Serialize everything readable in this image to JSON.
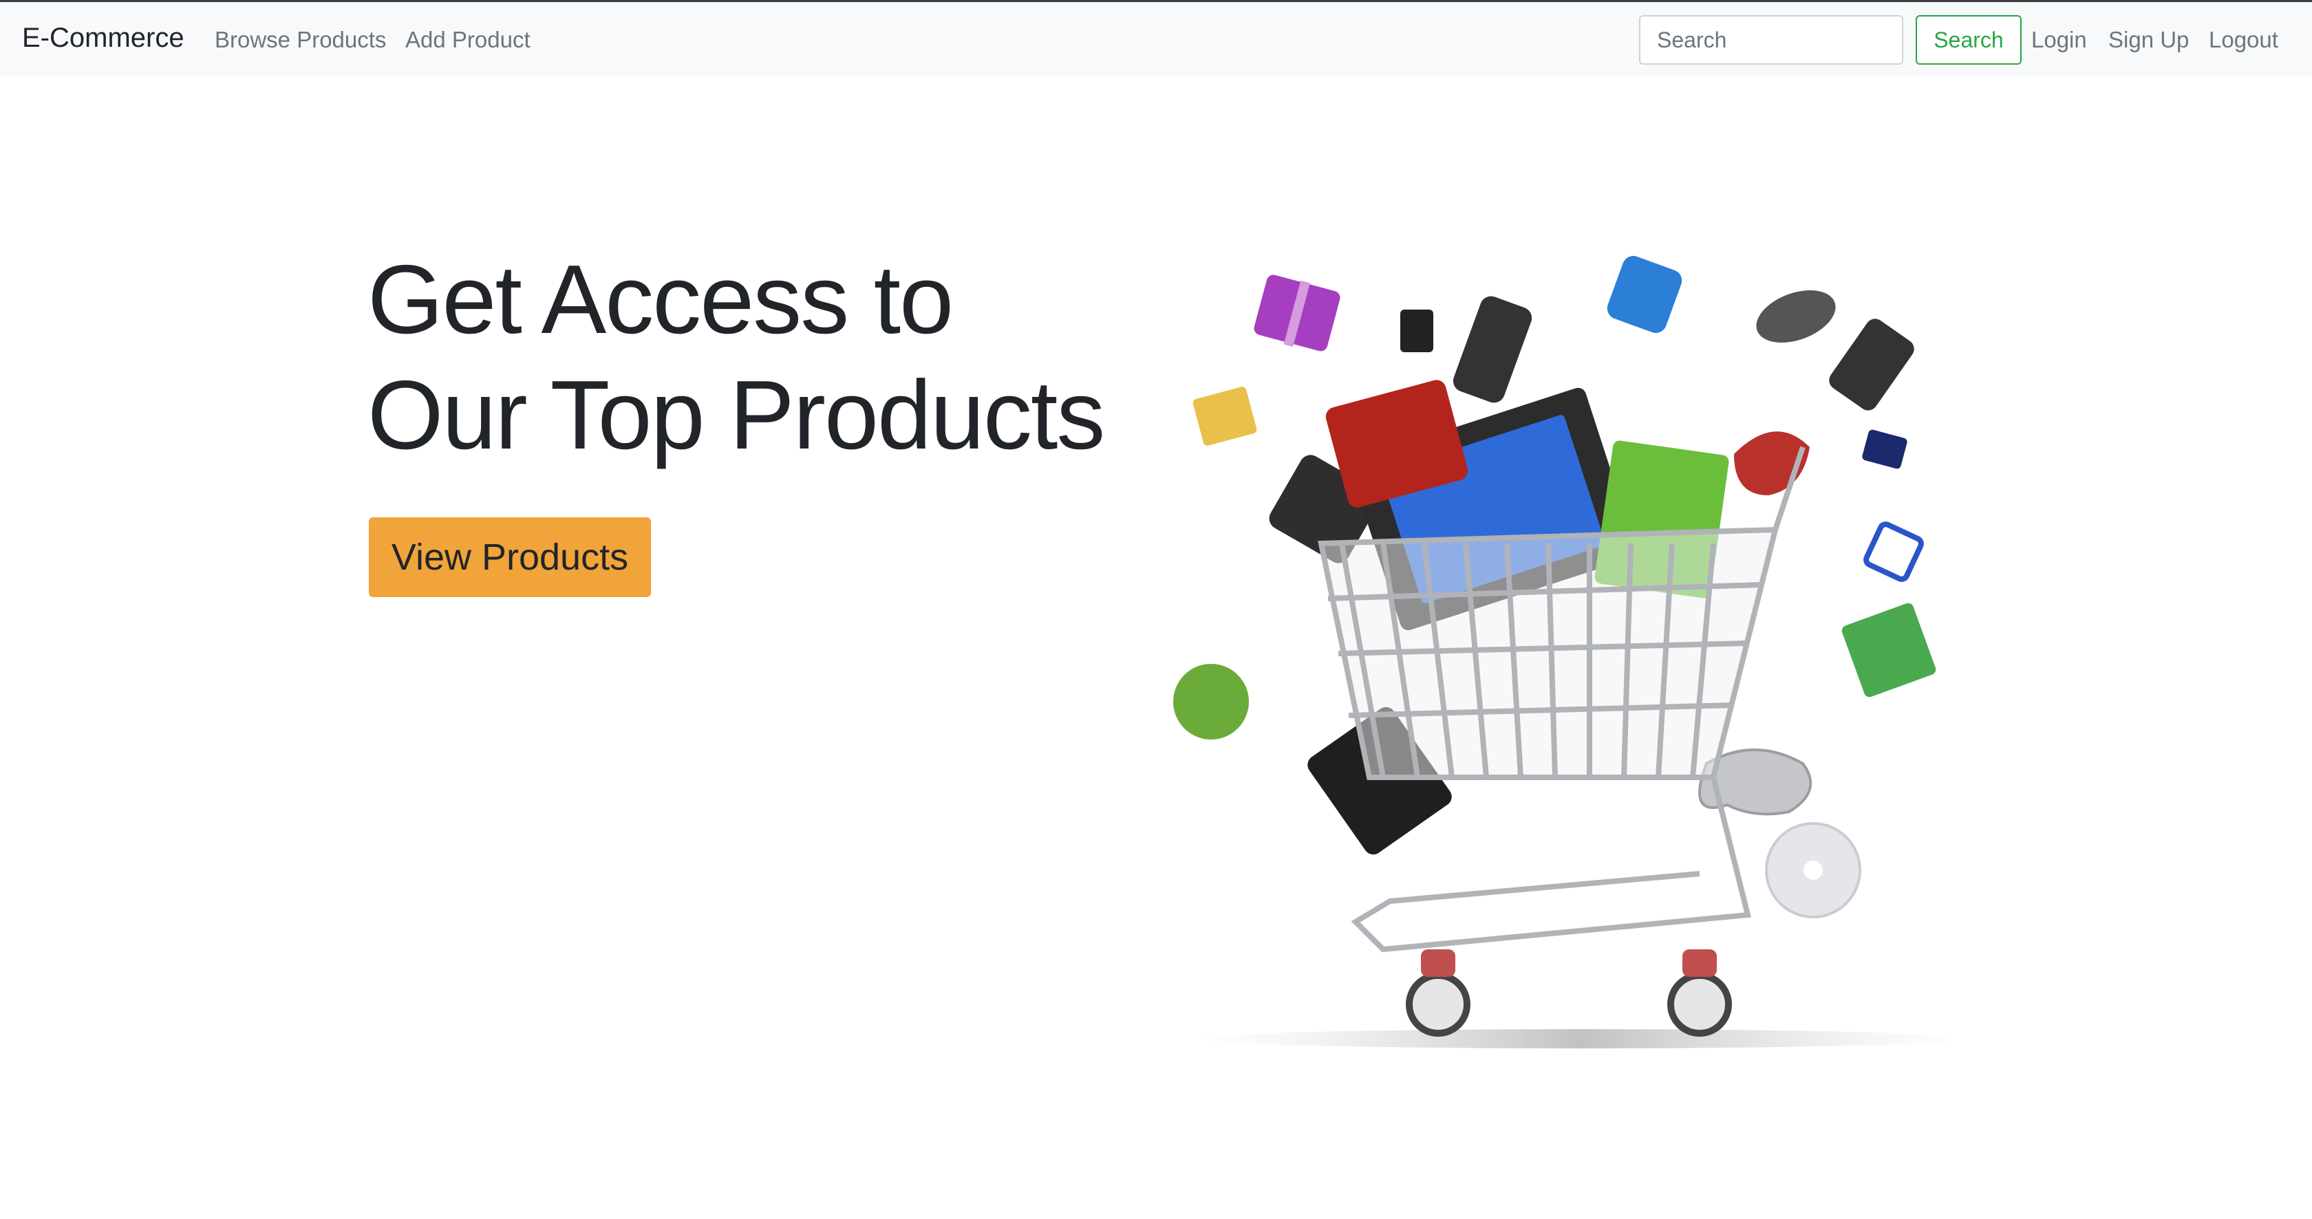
{
  "navbar": {
    "brand": "E-Commerce",
    "links": [
      "Browse Products",
      "Add Product"
    ],
    "search": {
      "placeholder": "Search",
      "button_label": "Search"
    },
    "auth_links": [
      "Login",
      "Sign Up",
      "Logout"
    ]
  },
  "hero": {
    "title_lines": [
      "Get Access to",
      "Our Top Products"
    ],
    "cta_label": "View Products",
    "illustration": "shopping-cart-with-electronics-and-gifts"
  },
  "colors": {
    "navbar_bg": "#f8f9fa",
    "text": "#212529",
    "muted": "#6c757d",
    "success": "#28a745",
    "cta": "#f1a43a"
  }
}
